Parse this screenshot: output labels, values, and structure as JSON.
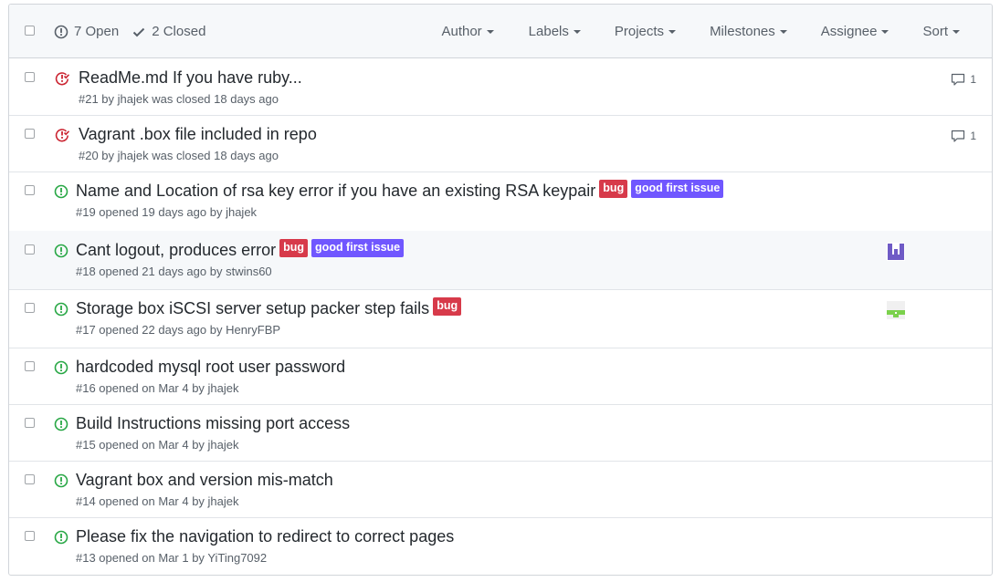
{
  "colors": {
    "open": "#28a745",
    "closed": "#cb2431",
    "bug": "#d73a4a",
    "good_first_issue": "#7057ff"
  },
  "header": {
    "open_label": "7 Open",
    "closed_label": "2 Closed",
    "filters": [
      {
        "label": "Author"
      },
      {
        "label": "Labels"
      },
      {
        "label": "Projects"
      },
      {
        "label": "Milestones"
      },
      {
        "label": "Assignee"
      },
      {
        "label": "Sort"
      }
    ]
  },
  "issues": [
    {
      "state": "closed",
      "icon": "issue-closed-icon",
      "title": "ReadMe.md If you have ruby...",
      "meta": "#21 by jhajek was closed 18 days ago",
      "labels": [],
      "comments": "1",
      "avatar": null
    },
    {
      "state": "closed",
      "icon": "issue-closed-icon",
      "title": "Vagrant .box file included in repo",
      "meta": "#20 by jhajek was closed 18 days ago",
      "labels": [],
      "comments": "1",
      "avatar": null
    },
    {
      "state": "open",
      "icon": "issue-opened-icon",
      "title": "Name and Location of rsa key error if you have an existing RSA keypair",
      "meta": "#19 opened 19 days ago by jhajek",
      "labels": [
        {
          "name": "bug",
          "color": "#d73a4a"
        },
        {
          "name": "good first issue",
          "color": "#7057ff"
        }
      ],
      "comments": null,
      "avatar": null
    },
    {
      "state": "open",
      "icon": "issue-opened-icon",
      "title": "Cant logout, produces error",
      "meta": "#18 opened 21 days ago by stwins60",
      "labels": [
        {
          "name": "bug",
          "color": "#d73a4a"
        },
        {
          "name": "good first issue",
          "color": "#7057ff"
        }
      ],
      "comments": null,
      "avatar": "purple-identicon"
    },
    {
      "state": "open",
      "icon": "issue-opened-icon",
      "title": "Storage box iSCSI server setup packer step fails",
      "meta": "#17 opened 22 days ago by HenryFBP",
      "labels": [
        {
          "name": "bug",
          "color": "#d73a4a"
        }
      ],
      "comments": null,
      "avatar": "green-identicon"
    },
    {
      "state": "open",
      "icon": "issue-opened-icon",
      "title": "hardcoded mysql root user password",
      "meta": "#16 opened on Mar 4 by jhajek",
      "labels": [],
      "comments": null,
      "avatar": null
    },
    {
      "state": "open",
      "icon": "issue-opened-icon",
      "title": "Build Instructions missing port access",
      "meta": "#15 opened on Mar 4 by jhajek",
      "labels": [],
      "comments": null,
      "avatar": null
    },
    {
      "state": "open",
      "icon": "issue-opened-icon",
      "title": "Vagrant box and version mis-match",
      "meta": "#14 opened on Mar 4 by jhajek",
      "labels": [],
      "comments": null,
      "avatar": null
    },
    {
      "state": "open",
      "icon": "issue-opened-icon",
      "title": "Please fix the navigation to redirect to correct pages",
      "meta": "#13 opened on Mar 1 by YiTing7092",
      "labels": [],
      "comments": null,
      "avatar": null
    }
  ]
}
